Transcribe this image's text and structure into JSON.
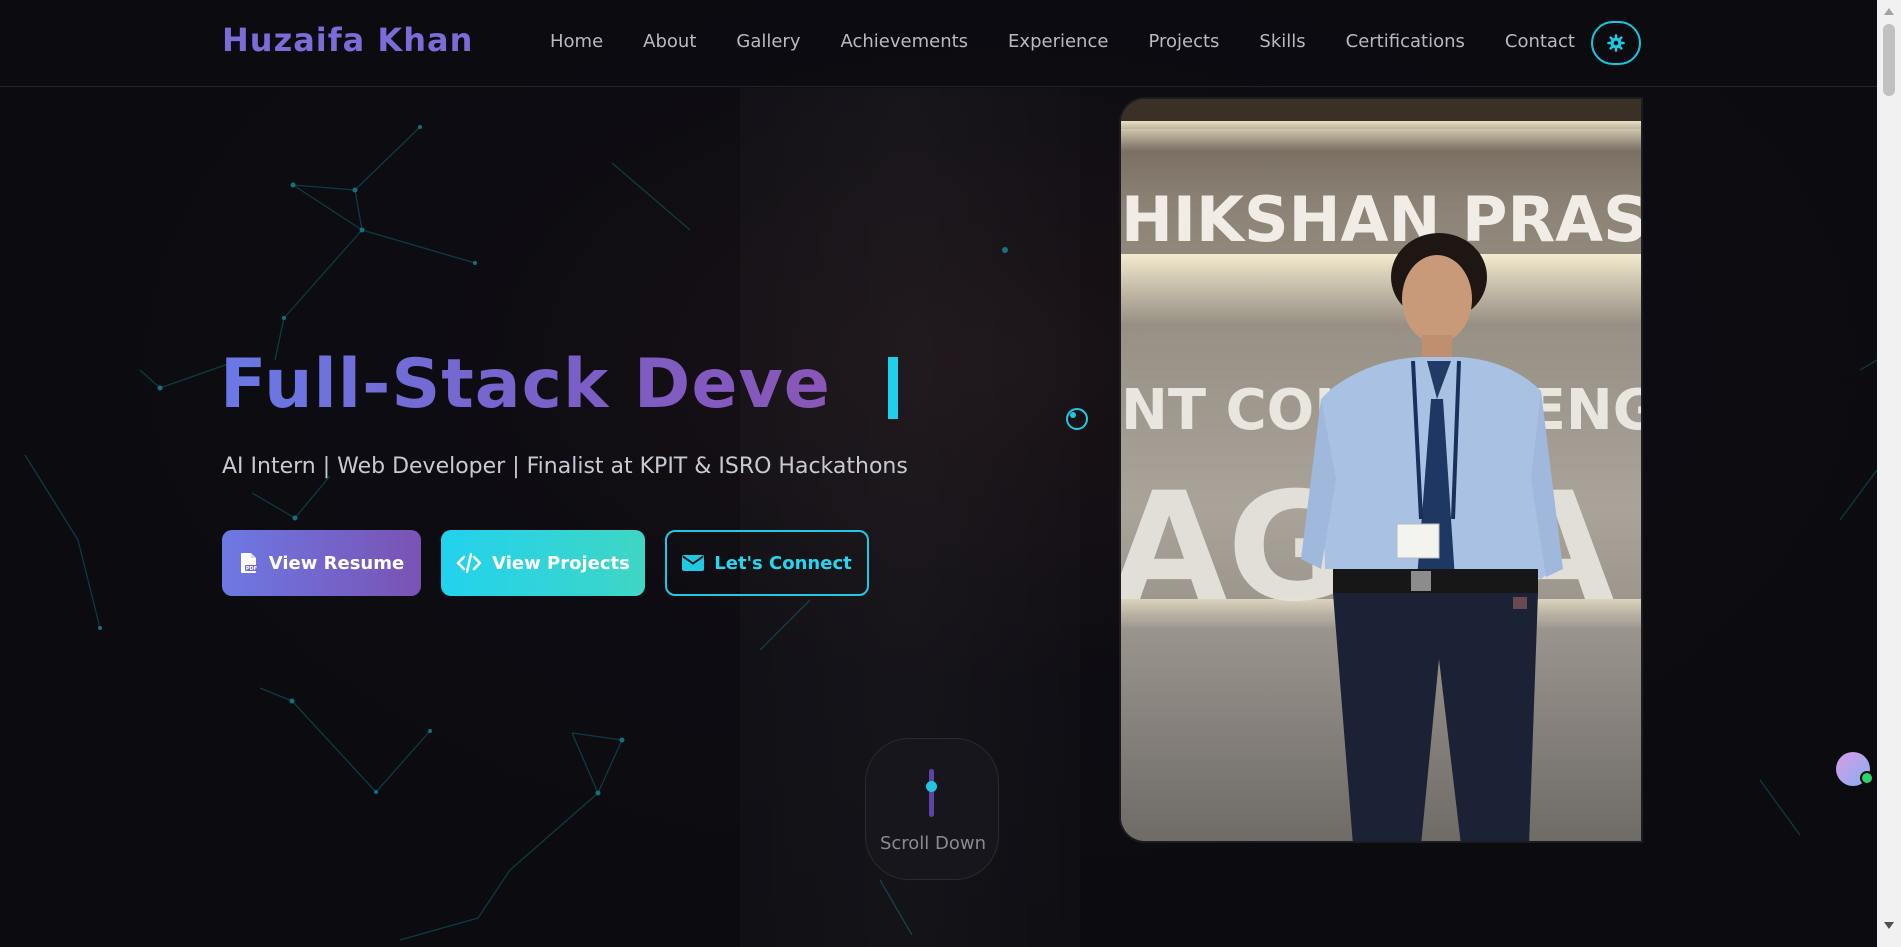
{
  "header": {
    "logo": "Huzaifa Khan",
    "nav": [
      "Home",
      "About",
      "Gallery",
      "Achievements",
      "Experience",
      "Projects",
      "Skills",
      "Certifications",
      "Contact"
    ],
    "theme_toggle_icon": "gear-icon"
  },
  "hero": {
    "headline": "Full-Stack Deve",
    "subtitle": "AI Intern | Web Developer | Finalist at KPIT & ISRO Hackathons",
    "buttons": {
      "resume": "View Resume",
      "projects": "View Projects",
      "connect": "Let's Connect"
    },
    "scroll_label": "Scroll Down"
  },
  "photo": {
    "sign_line1": "HIKSHAN PRASARAK",
    "sign_line2": "NT COLLEGE ENGINEER",
    "sign_line3": "AG LA"
  },
  "colors": {
    "accent_cyan": "#1fc9e2",
    "accent_purple": "#7b6cd8",
    "background": "#0b0b10"
  }
}
